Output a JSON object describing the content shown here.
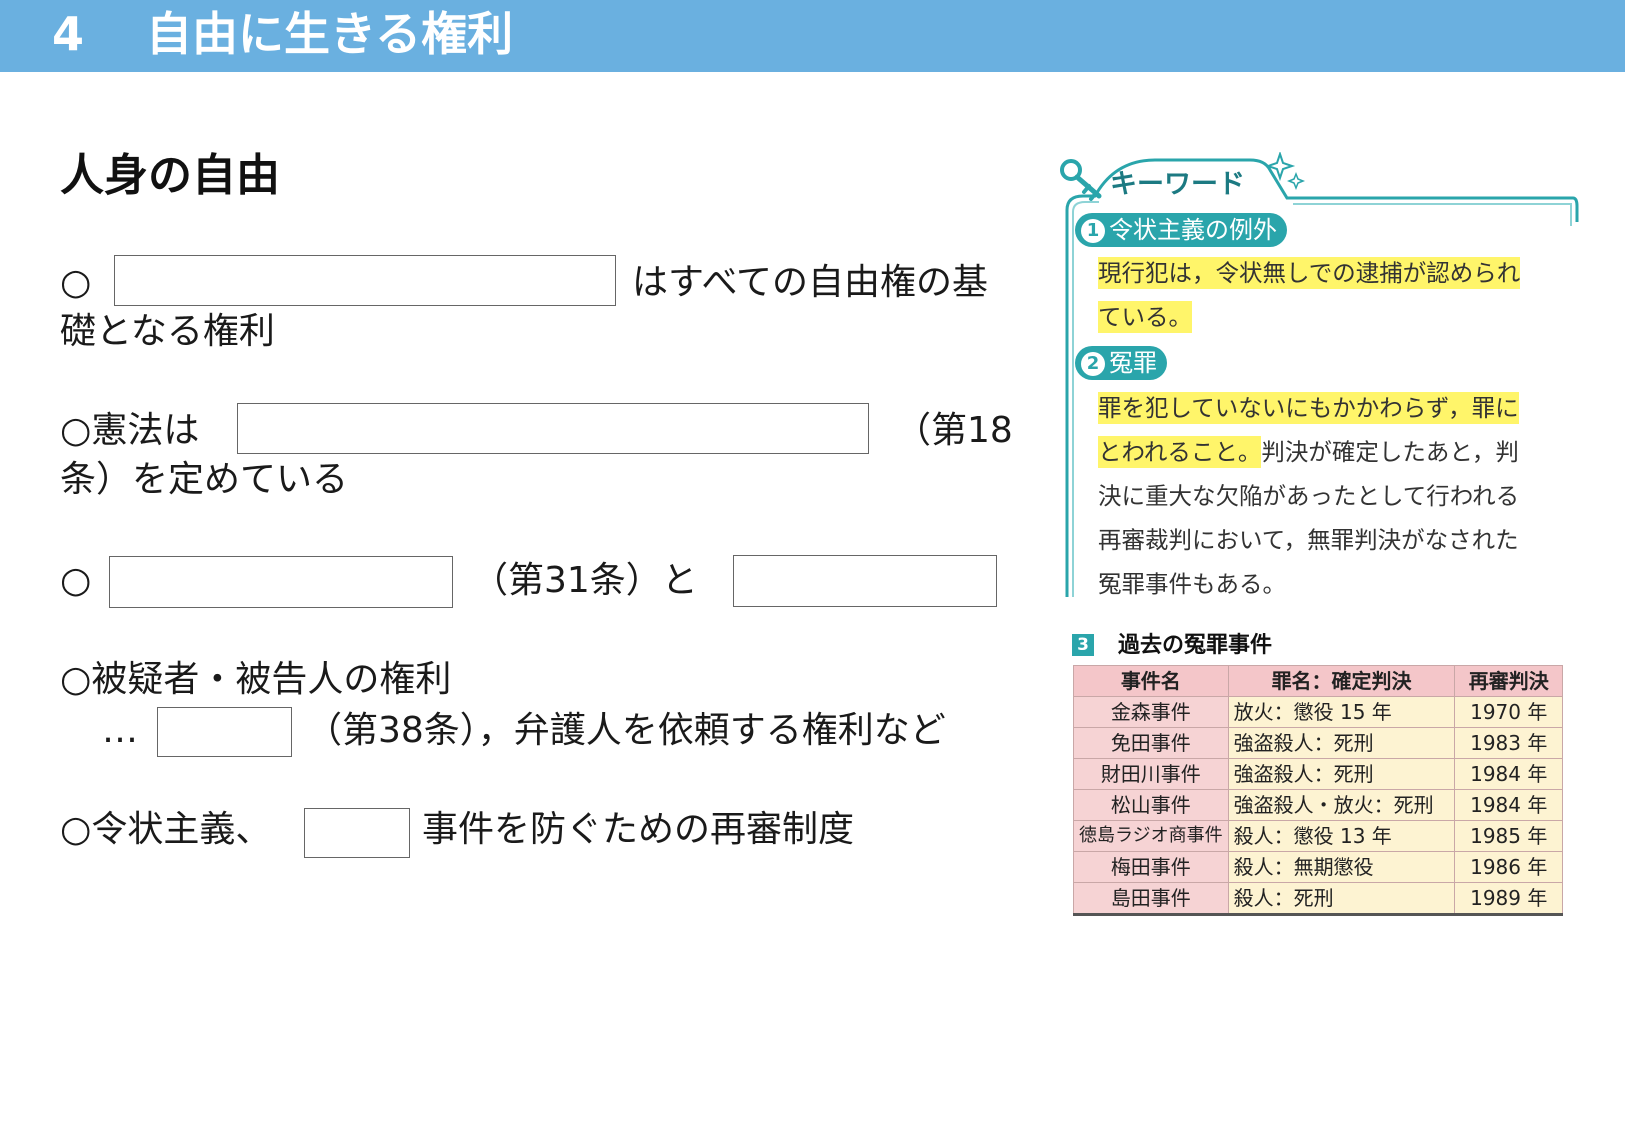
{
  "banner": {
    "number": "4",
    "title": "自由に生きる権利"
  },
  "section_title": "人身の自由",
  "items": {
    "item1": {
      "prefix": "○",
      "after": "はすべての自由権の基",
      "cont": "礎となる権利"
    },
    "item2": {
      "prefix": "○憲法は",
      "after": "（第18",
      "cont": "条）を定めている"
    },
    "item3": {
      "prefix": "○",
      "middle": "（第31条）と"
    },
    "item4": {
      "line1": "○被疑者・被告人の権利",
      "prefix": "…",
      "after": "（第38条），弁護人を依頼する権利など"
    },
    "item5": {
      "prefix": "○令状主義、",
      "after": "事件を防ぐための再審制度"
    }
  },
  "keyword_panel": {
    "tab_label": "キーワード",
    "k1": {
      "num": "1",
      "title": "令状主義の例外",
      "lines": [
        "現行犯は，令状無しでの逮捕が認められ",
        "ている。"
      ]
    },
    "k2": {
      "num": "2",
      "title": "冤罪",
      "line1": "罪を犯していないにもかかわらず，罪に",
      "line2_hl": "とわれること。",
      "line2_rest": "判決が確定したあと，判",
      "line3": "決に重大な欠陥があったとして行われる",
      "line4": "再審裁判において，無罪判決がなされた",
      "line5": "冤罪事件もある。"
    }
  },
  "cases_table": {
    "num": "3",
    "caption": "過去の冤罪事件",
    "headers": [
      "事件名",
      "罪名：確定判決",
      "再審判決"
    ],
    "rows": [
      [
        "金森事件",
        "放火：懲役 15 年",
        "1970 年"
      ],
      [
        "免田事件",
        "強盗殺人：死刑",
        "1983 年"
      ],
      [
        "財田川事件",
        "強盗殺人：死刑",
        "1984 年"
      ],
      [
        "松山事件",
        "強盗殺人・放火：死刑",
        "1984 年"
      ],
      [
        "徳島ラジオ商事件",
        "殺人：懲役 13 年",
        "1985 年"
      ],
      [
        "梅田事件",
        "殺人：無期懲役",
        "1986 年"
      ],
      [
        "島田事件",
        "殺人：死刑",
        "1989 年"
      ]
    ]
  },
  "colors": {
    "banner": "#6ab0e0",
    "accent": "#2aa5ab",
    "highlight": "#fff56a",
    "table_header": "#f4c6c9",
    "table_name_cell": "#f6d3d4",
    "table_cell": "#fdf3d2"
  }
}
